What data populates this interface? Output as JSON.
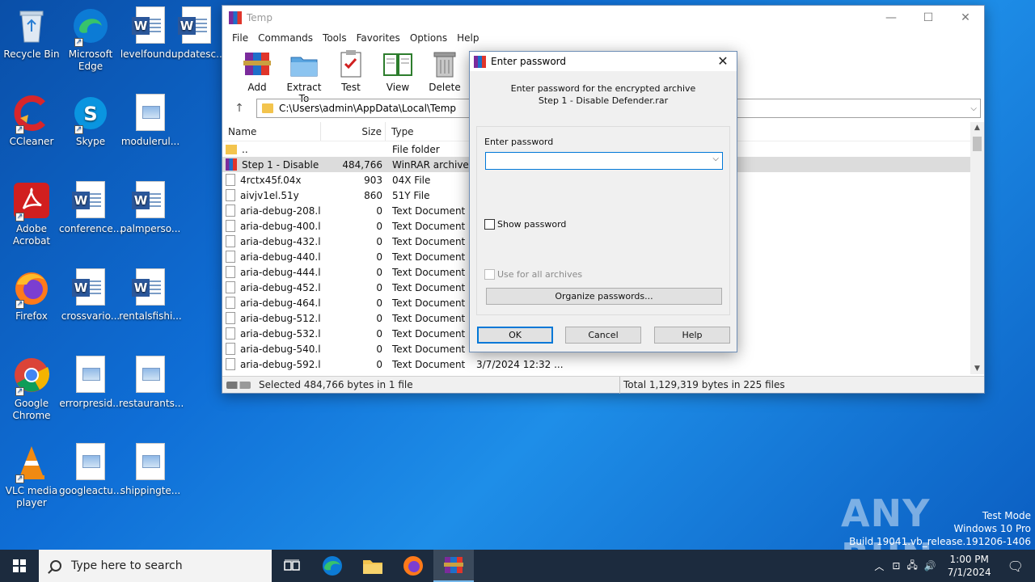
{
  "desktop": {
    "icons": [
      {
        "label": "Recycle Bin"
      },
      {
        "label": "Microsoft Edge"
      },
      {
        "label": "levelfound..."
      },
      {
        "label": "updatesc..."
      },
      {
        "label": "CCleaner"
      },
      {
        "label": "Skype"
      },
      {
        "label": "modulerul..."
      },
      {
        "label": "Adobe Acrobat"
      },
      {
        "label": "conference..."
      },
      {
        "label": "palmperso..."
      },
      {
        "label": "Firefox"
      },
      {
        "label": "crossvario..."
      },
      {
        "label": "rentalsfishi..."
      },
      {
        "label": "Google Chrome"
      },
      {
        "label": "errorpresid..."
      },
      {
        "label": "restaurants..."
      },
      {
        "label": "VLC media player"
      },
      {
        "label": "googleactu..."
      },
      {
        "label": "shippingte..."
      }
    ]
  },
  "winrar": {
    "title": "Temp",
    "menu": [
      "File",
      "Commands",
      "Tools",
      "Favorites",
      "Options",
      "Help"
    ],
    "toolbar": [
      "Add",
      "Extract To",
      "Test",
      "View",
      "Delete"
    ],
    "path": "C:\\Users\\admin\\AppData\\Local\\Temp",
    "columns": {
      "name": "Name",
      "size": "Size",
      "type": "Type"
    },
    "files": [
      {
        "name": "..",
        "size": "",
        "type": "File folder",
        "modified": "",
        "icon": "folder"
      },
      {
        "name": "Step 1 - Disable ...",
        "size": "484,766",
        "type": "WinRAR archive",
        "modified": "",
        "icon": "rar",
        "selected": true
      },
      {
        "name": "4rctx45f.04x",
        "size": "903",
        "type": "04X File",
        "modified": "",
        "icon": "file"
      },
      {
        "name": "aivjv1el.51y",
        "size": "860",
        "type": "51Y File",
        "modified": "",
        "icon": "file"
      },
      {
        "name": "aria-debug-208.l...",
        "size": "0",
        "type": "Text Document",
        "modified": "",
        "icon": "file"
      },
      {
        "name": "aria-debug-400.l...",
        "size": "0",
        "type": "Text Document",
        "modified": "",
        "icon": "file"
      },
      {
        "name": "aria-debug-432.l...",
        "size": "0",
        "type": "Text Document",
        "modified": "",
        "icon": "file"
      },
      {
        "name": "aria-debug-440.l...",
        "size": "0",
        "type": "Text Document",
        "modified": "",
        "icon": "file"
      },
      {
        "name": "aria-debug-444.l...",
        "size": "0",
        "type": "Text Document",
        "modified": "",
        "icon": "file"
      },
      {
        "name": "aria-debug-452.l...",
        "size": "0",
        "type": "Text Document",
        "modified": "",
        "icon": "file"
      },
      {
        "name": "aria-debug-464.l...",
        "size": "0",
        "type": "Text Document",
        "modified": "",
        "icon": "file"
      },
      {
        "name": "aria-debug-512.l...",
        "size": "0",
        "type": "Text Document",
        "modified": "",
        "icon": "file"
      },
      {
        "name": "aria-debug-532.l...",
        "size": "0",
        "type": "Text Document",
        "modified": "",
        "icon": "file"
      },
      {
        "name": "aria-debug-540.l...",
        "size": "0",
        "type": "Text Document",
        "modified": "",
        "icon": "file"
      },
      {
        "name": "aria-debug-592.l...",
        "size": "0",
        "type": "Text Document",
        "modified": "3/7/2024 12:32 ...",
        "icon": "file"
      }
    ],
    "status_left": "Selected 484,766 bytes in 1 file",
    "status_right": "Total 1,129,319 bytes in 225 files"
  },
  "dialog": {
    "title": "Enter password",
    "message_line1": "Enter password for the encrypted archive",
    "message_line2": "Step 1 - Disable Defender.rar",
    "field_label": "Enter password",
    "password_value": "",
    "show_password": "Show password",
    "use_for_all": "Use for all archives",
    "organize": "Organize passwords...",
    "ok": "OK",
    "cancel": "Cancel",
    "help": "Help"
  },
  "watermark": "ANY RUN",
  "system": {
    "testmode_1": "Test Mode",
    "testmode_2": "Windows 10 Pro",
    "testmode_3": "Build 19041.vb_release.191206-1406"
  },
  "taskbar": {
    "search_placeholder": "Type here to search",
    "time": "1:00 PM",
    "date": "7/1/2024"
  }
}
